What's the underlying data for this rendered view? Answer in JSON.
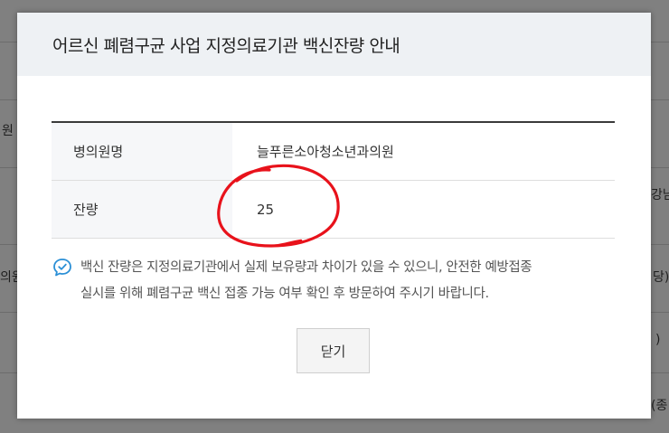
{
  "background": {
    "fragments": [
      "원",
      "의원",
      "강남",
      "당)",
      ")",
      "(종"
    ]
  },
  "modal": {
    "title": "어르신 폐렴구균 사업 지정의료기관 백신잔량 안내",
    "rows": [
      {
        "label": "병의원명",
        "value": "늘푸른소아청소년과의원"
      },
      {
        "label": "잔량",
        "value": "25"
      }
    ],
    "notice_icon": "chat-check-icon",
    "notice_lines": [
      "백신 잔량은 지정의료기관에서 실제 보유량과 차이가 있을 수 있으니, 안전한 예방접종",
      "실시를 위해 폐렴구균 백신 접종 가능 여부 확인 후 방문하여 주시기 바랍니다."
    ],
    "close_label": "닫기"
  },
  "colors": {
    "accent": "#2a8fd6",
    "annotation": "#e8121b",
    "header_bg": "#eef1f4"
  }
}
